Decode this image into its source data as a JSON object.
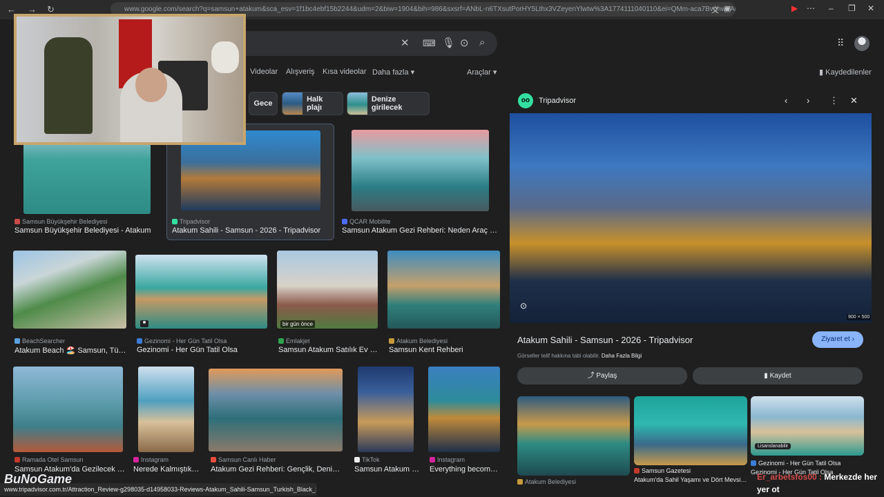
{
  "browser": {
    "url": "www.google.com/search?q=samsun+atakum&sca_esv=1f1bc4ebf15b2244&udm=2&biw=1904&bih=986&sxsrf=ANbL-n6TXsutPorHY5Lthx3VZeyenYlwtw%3A1774111040110&ei=QMm-aca7BvqhwPAPjbuss",
    "status_url": "www.tripadvisor.com.tr/Attraction_Review-g298035-d14958033-Reviews-Atakum_Sahili-Samsun_Turkish_Black_Sea_Coast.html"
  },
  "search": {
    "tabs": [
      "Videolar",
      "Alışveriş",
      "Kısa videolar",
      "Daha fazla",
      "Araçlar"
    ],
    "saved_label": "Kaydedilenler"
  },
  "chips": [
    "Gece",
    "Halk plajı",
    "Denize girilecek"
  ],
  "results": [
    {
      "source": "Samsun Büyükşehir Belediyesi",
      "title": "Samsun Büyükşehir Belediyesi - Atakum",
      "color": "#c94a4a"
    },
    {
      "source": "Tripadvisor",
      "title": "Atakum Sahili - Samsun - 2026 - Tripadvisor",
      "color": "#34e0a1"
    },
    {
      "source": "QCAR Mobilite",
      "title": "Samsun Atakum Gezi Rehberi: Neden Araç Kirala...",
      "color": "#4a6cf7"
    },
    {
      "source": "BeachSearcher",
      "title": "Atakum Beach 🏖️ Samsun, Türkiy...",
      "color": "#5aa0e0"
    },
    {
      "source": "Gezinomi - Her Gün Tatil Olsa",
      "title": "Gezinomi - Her Gün Tatil Olsa",
      "color": "#3b7dd8"
    },
    {
      "source": "Emlakjet",
      "title": "Samsun Atakum Satılık Ev Fly...",
      "color": "#2ea44f"
    },
    {
      "source": "Atakum Belediyesi",
      "title": "Samsun Kent Rehberi",
      "color": "#c59b3a"
    },
    {
      "source": "Ramada Otel Samsun",
      "title": "Samsun Atakum'da Gezilecek Yer...",
      "color": "#c0392b"
    },
    {
      "source": "Instagram",
      "title": "Nerede Kalmıştık ...",
      "color": "#d6249f"
    },
    {
      "source": "Samsun Canlı Haber",
      "title": "Atakum Gezi Rehberi: Gençlik, Deniz ve ...",
      "color": "#e74c3c"
    },
    {
      "source": "TikTok",
      "title": "Samsun Atakum 2...",
      "color": "#eeeeee"
    },
    {
      "source": "Instagram",
      "title": "Everything becomes...",
      "color": "#d6249f"
    }
  ],
  "badges": {
    "time_ago": "bir gün önce"
  },
  "panel": {
    "site": "Tripadvisor",
    "title": "Atakum Sahili - Samsun - 2026 - Tripadvisor",
    "visit": "Ziyaret et",
    "copyright": "Görseller telif hakkına tabi olabilir.",
    "more_info": "Daha Fazla Bilgi",
    "share": "Paylaş",
    "save": "Kaydet",
    "dimensions": "900 × 500",
    "related": [
      {
        "source": "Atakum Belediyesi",
        "title": ""
      },
      {
        "source": "Samsun Gazetesi",
        "title": "Atakum'da Sahil Yaşamı ve Dört Mevsim..."
      },
      {
        "source": "Gezinomi - Her Gün Tatil Olsa",
        "title": "Gezinomi - Her Gün Tatil Olsa",
        "badge": "Lisanslanabilir"
      }
    ]
  },
  "overlay": {
    "watermark": "BuNoGame",
    "chat_user": "Er_arbetsfos00 :",
    "chat_text": "Merkezde her yer ot"
  },
  "colors": {
    "bg": "#1f1f1f",
    "accent": "#8ab4f8",
    "webcam_frame": "#c7a56b"
  }
}
